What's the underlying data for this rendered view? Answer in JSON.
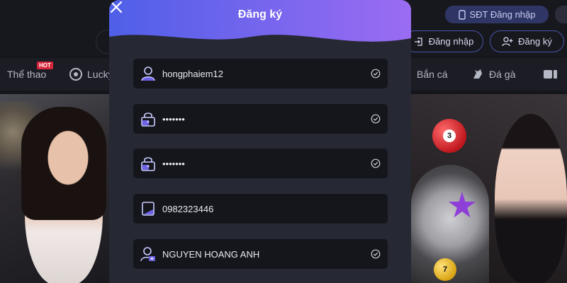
{
  "header": {
    "sdt_login_label": "SĐT Đăng nhập",
    "login_label": "Đăng nhập",
    "register_label": "Đăng ký"
  },
  "nav": {
    "items": [
      {
        "label": "Thể thao",
        "badge": "HOT",
        "icon": "sports-icon"
      },
      {
        "label": "Lucky",
        "icon": "lottery-icon"
      },
      {
        "label": "Bắn cá",
        "icon": "fish-icon"
      },
      {
        "label": "Đá gà",
        "icon": "rooster-icon"
      }
    ]
  },
  "banners": {
    "right_balls": [
      "3",
      "7"
    ]
  },
  "modal": {
    "title": "Đăng ký",
    "fields": [
      {
        "icon": "user-icon",
        "value": "hongphaiem12",
        "verified": true
      },
      {
        "icon": "lock-icon",
        "value": "•••••••",
        "verified": true
      },
      {
        "icon": "lock-icon",
        "value": "•••••••",
        "verified": true
      },
      {
        "icon": "phone-icon",
        "value": "0982323446",
        "verified": false
      },
      {
        "icon": "user-add-icon",
        "value": "NGUYEN HOANG ANH",
        "verified": true
      }
    ]
  },
  "colors": {
    "accent_start": "#4f5fe8",
    "accent_end": "#9b6cf2",
    "modal_bg": "#262833",
    "field_bg": "#15161c"
  }
}
